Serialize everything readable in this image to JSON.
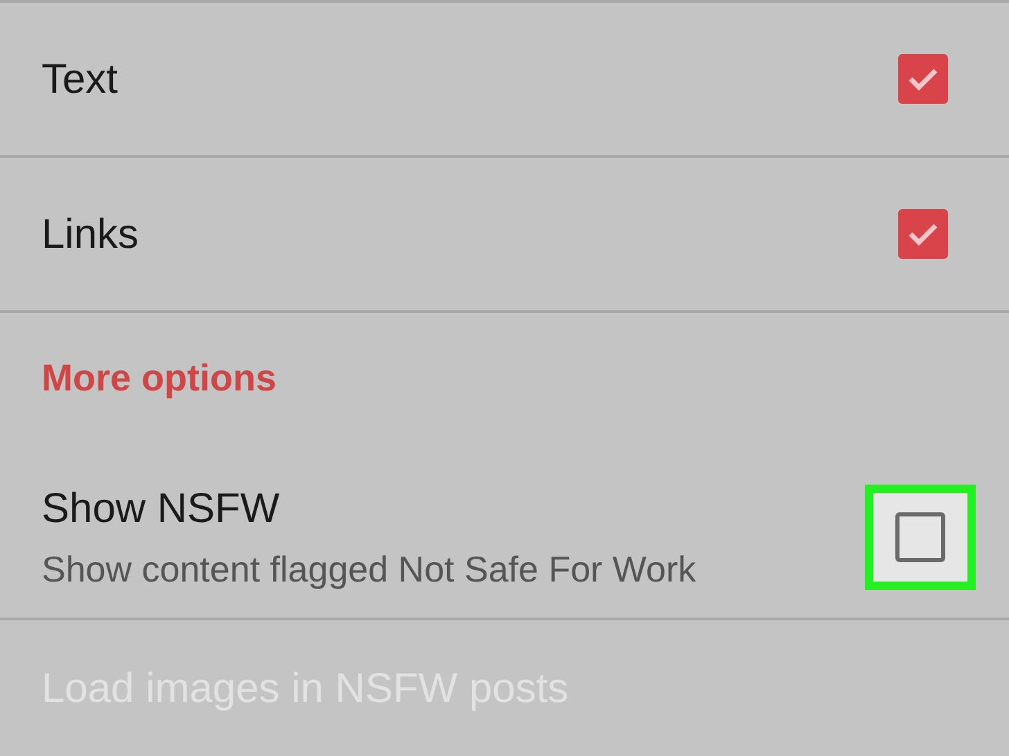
{
  "settings": [
    {
      "kind": "toggle",
      "label": "Text",
      "checked": true
    },
    {
      "kind": "toggle",
      "label": "Links",
      "checked": true
    },
    {
      "kind": "header",
      "label": "More options"
    },
    {
      "kind": "toggle",
      "label": "Show NSFW",
      "description": "Show content flagged Not Safe For Work",
      "checked": false,
      "highlighted": true
    },
    {
      "kind": "toggle",
      "label": "Load images in NSFW posts",
      "disabled": true
    }
  ]
}
